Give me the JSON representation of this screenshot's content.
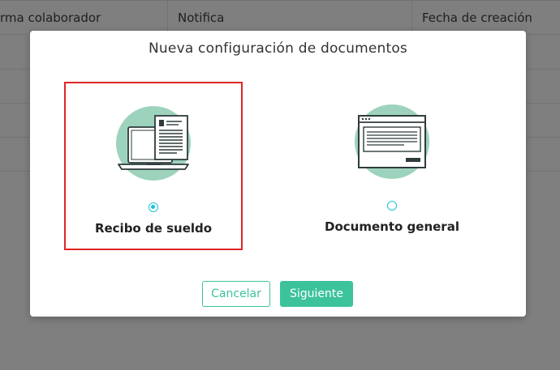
{
  "table": {
    "columns": [
      "rma colaborador",
      "Notifica",
      "Fecha de creación"
    ]
  },
  "modal": {
    "title": "Nueva configuración de documentos",
    "options": [
      {
        "label": "Recibo de sueldo",
        "icon": "laptop-payslip-icon",
        "selected": true
      },
      {
        "label": "Documento general",
        "icon": "browser-document-icon",
        "selected": false
      }
    ],
    "buttons": {
      "cancel_label": "Cancelar",
      "next_label": "Siguiente"
    }
  },
  "colors": {
    "accent": "#3cc39b",
    "radio": "#19c4d8",
    "illustration_circle": "#9dd3bd",
    "highlight_border": "#e02424"
  }
}
